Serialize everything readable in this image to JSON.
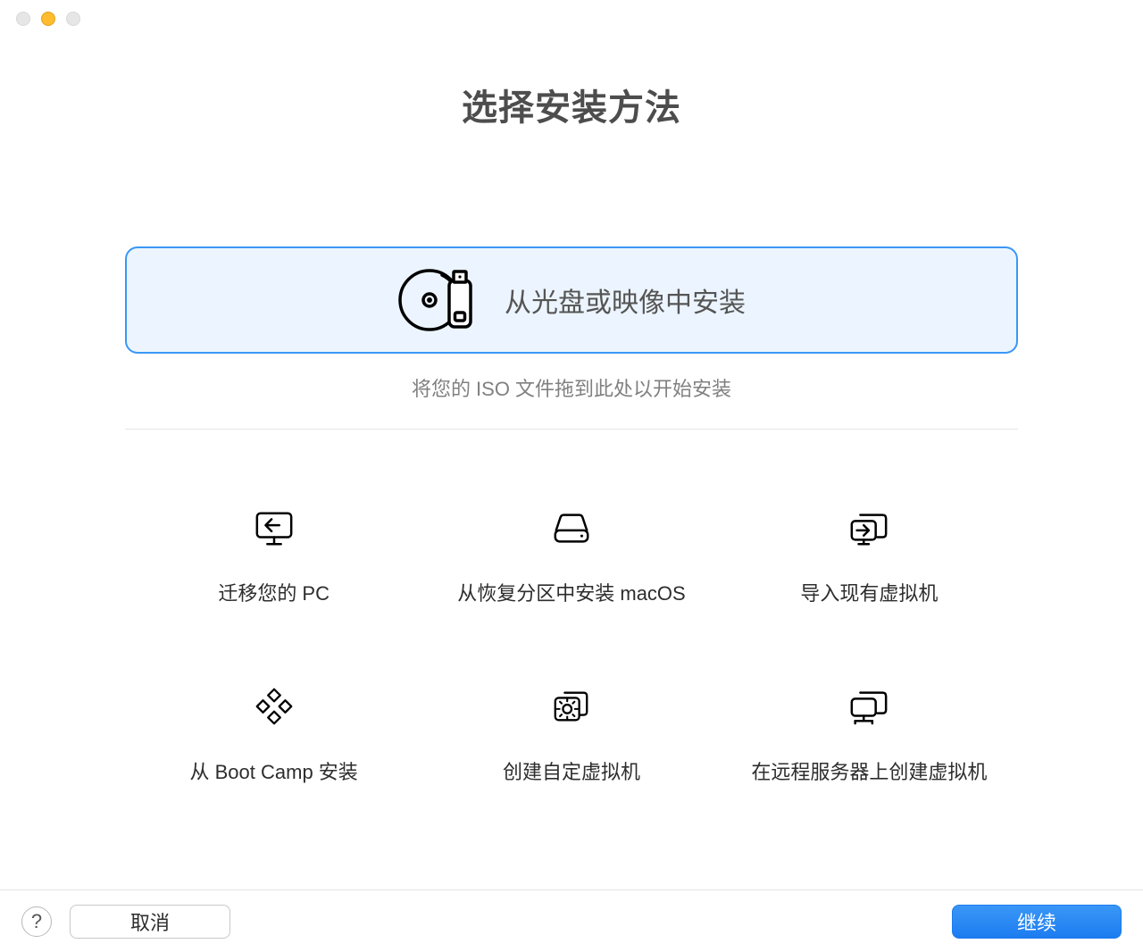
{
  "window": {
    "title": "选择安装方法"
  },
  "primary_option": {
    "label": "从光盘或映像中安装",
    "icon": "disc-usb-icon",
    "hint": "将您的 ISO 文件拖到此处以开始安装"
  },
  "options": [
    {
      "id": "migrate-pc",
      "label": "迁移您的 PC",
      "icon": "display-import-icon"
    },
    {
      "id": "recovery-macos",
      "label": "从恢复分区中安装 macOS",
      "icon": "hard-drive-icon"
    },
    {
      "id": "import-vm",
      "label": "导入现有虚拟机",
      "icon": "display-into-icon"
    },
    {
      "id": "bootcamp",
      "label": "从 Boot Camp 安装",
      "icon": "diamonds-icon"
    },
    {
      "id": "custom-vm",
      "label": "创建自定虚拟机",
      "icon": "gear-stack-icon"
    },
    {
      "id": "remote-vm",
      "label": "在远程服务器上创建虚拟机",
      "icon": "display-network-icon"
    }
  ],
  "footer": {
    "help_label": "?",
    "cancel_label": "取消",
    "continue_label": "继续"
  }
}
